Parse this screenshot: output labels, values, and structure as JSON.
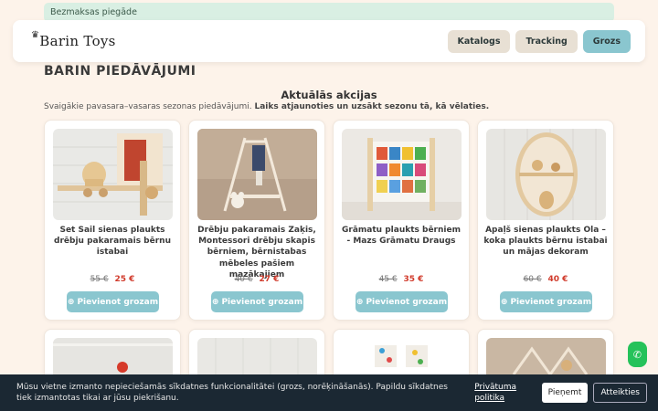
{
  "topbar": {
    "text": "Bezmaksas piegāde"
  },
  "header": {
    "logo_text": "Barin Toys",
    "nav": [
      {
        "label": "Katalogs"
      },
      {
        "label": "Tracking"
      },
      {
        "label": "Grozs"
      }
    ]
  },
  "page": {
    "title": "BARIN PIEDĀVĀJUMI",
    "section_title": "Aktuālās akcijas",
    "subtitle": "Svaigākie pavasara–vasaras sezonas piedāvājumi.",
    "subtitle_bold": "Laiks atjaunoties un uzsākt sezonu tā, kā vēlaties."
  },
  "products": [
    {
      "name": "Set Sail sienas plaukts drēbju pakaramais bērnu istabai",
      "old_price": "55 €",
      "new_price": "25 €",
      "button": "Pievienot grozam"
    },
    {
      "name": "Drēbju pakaramais Zaķis, Montessori drēbju skapis bērniem, bērnistabas mēbeles pašiem mazākajiem",
      "old_price": "40 €",
      "new_price": "27 €",
      "button": "Pievienot grozam"
    },
    {
      "name": "Grāmatu plaukts bērniem - Mazs Grāmatu Draugs",
      "old_price": "45 €",
      "new_price": "35 €",
      "button": "Pievienot grozam"
    },
    {
      "name": "Apaļš sienas plaukts Ola – koka plaukts bērnu istabai un mājas dekoram",
      "old_price": "60 €",
      "new_price": "40 €",
      "button": "Pievienot grozam"
    }
  ],
  "cookie": {
    "text": "Mūsu vietne izmanto nepieciešamās sīkdatnes funkcionalitātei (grozs, norēķināšanās). Papildu sīkdatnes tiek izmantotas tikai ar jūsu piekrišanu.",
    "policy_link": "Privātuma politika",
    "accept": "Pieņemt",
    "reject": "Atteikties"
  },
  "colors": {
    "accent": "#8ac6cf",
    "sale": "#d13b2c",
    "banner": "#d9efe3",
    "cookie_bg": "#1b2833"
  }
}
